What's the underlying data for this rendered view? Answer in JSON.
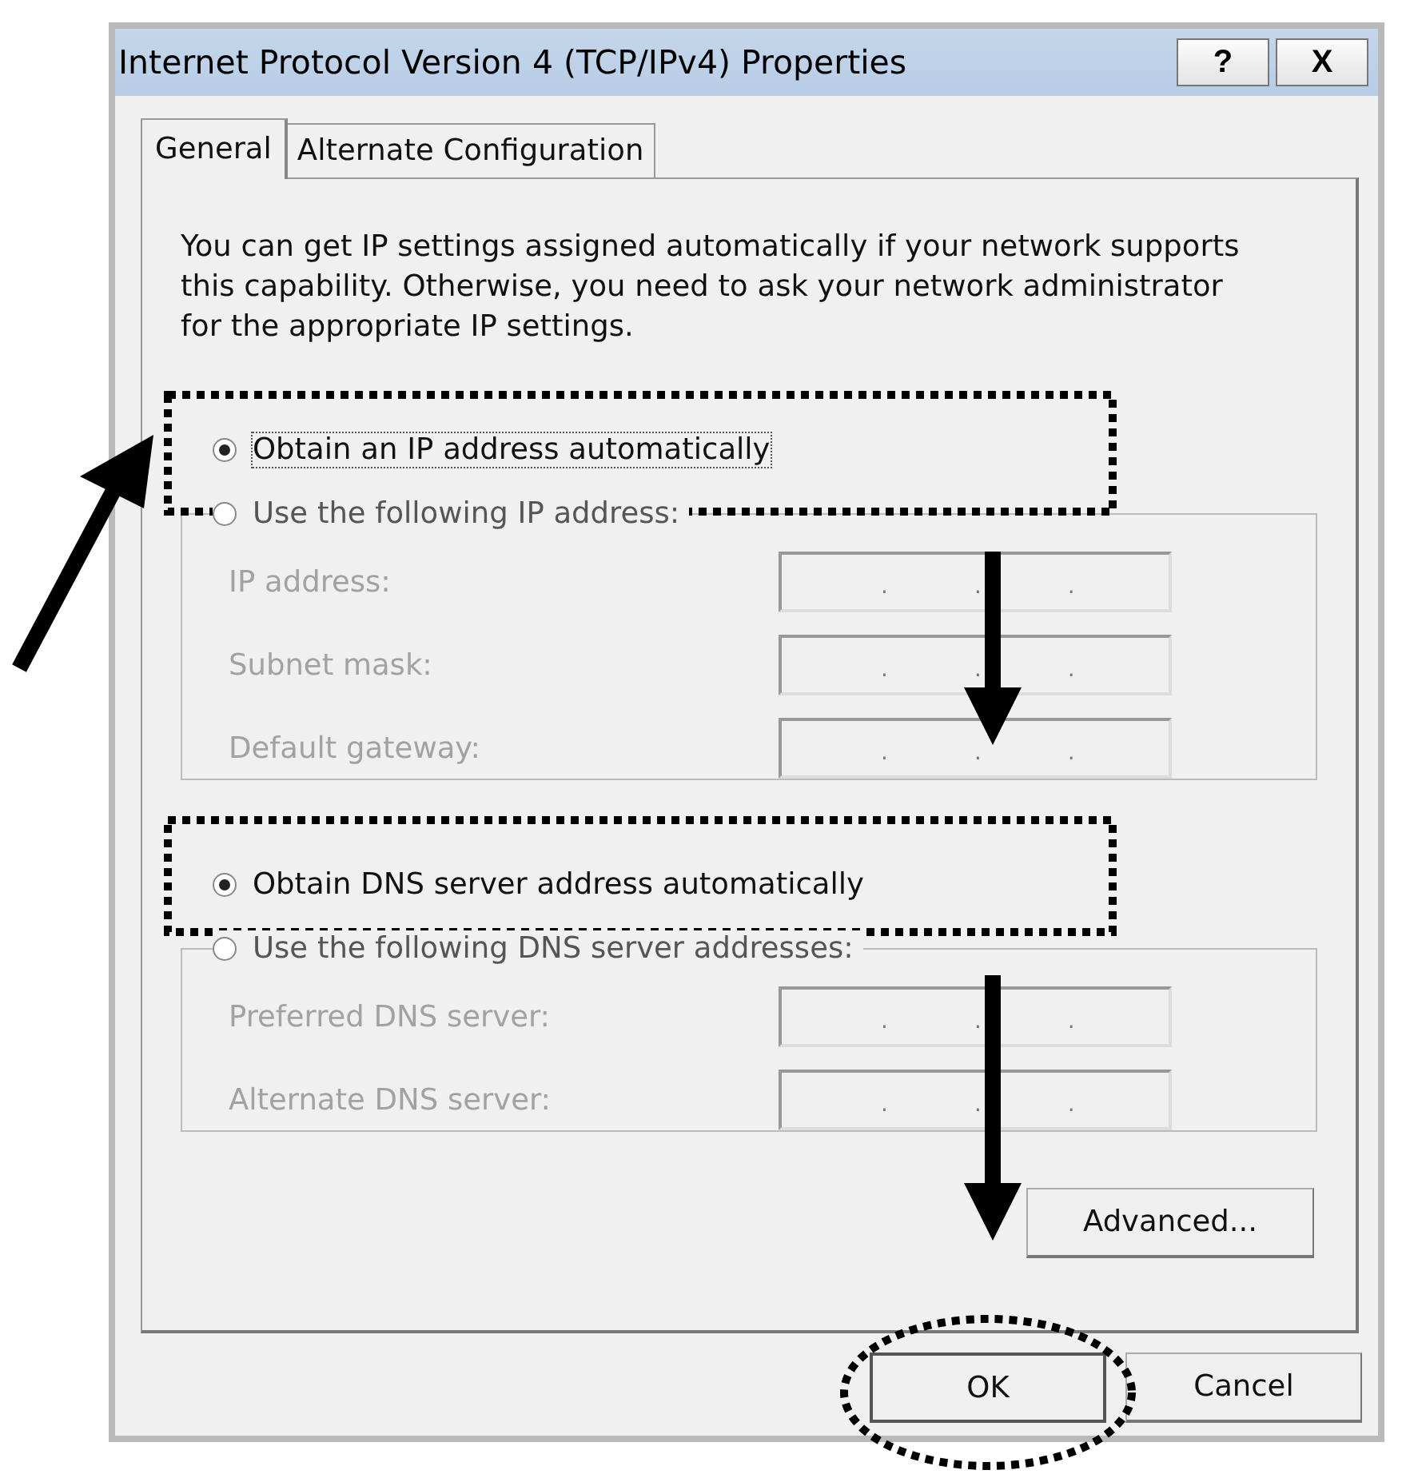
{
  "window": {
    "title": "Internet Protocol Version 4 (TCP/IPv4) Properties",
    "help_button": "?",
    "close_button": "X"
  },
  "tabs": [
    {
      "label": "General",
      "selected": true
    },
    {
      "label": "Alternate Configuration",
      "selected": false
    }
  ],
  "intro": "You can get IP settings assigned automatically if your network supports this capability. Otherwise, you need to ask your network administrator for the appropriate IP settings.",
  "ip_section": {
    "auto_option": {
      "label": "Obtain an IP address automatically",
      "selected": true
    },
    "manual_option": {
      "label": "Use the following IP address:",
      "selected": false
    },
    "fields": [
      {
        "label": "IP address:",
        "disabled": true,
        "dots": [
          ".",
          ".",
          "."
        ]
      },
      {
        "label": "Subnet mask:",
        "disabled": true,
        "dots": [
          ".",
          ".",
          "."
        ]
      },
      {
        "label": "Default gateway:",
        "disabled": true,
        "dots": [
          ".",
          ".",
          "."
        ]
      }
    ]
  },
  "dns_section": {
    "auto_option": {
      "label": "Obtain DNS server address automatically",
      "selected": true
    },
    "manual_option": {
      "label": "Use the following DNS server addresses:",
      "selected": false
    },
    "fields": [
      {
        "label": "Preferred DNS server:",
        "disabled": true,
        "dots": [
          ".",
          ".",
          "."
        ]
      },
      {
        "label": "Alternate DNS server:",
        "disabled": true,
        "dots": [
          ".",
          ".",
          "."
        ]
      }
    ]
  },
  "advanced_button": "Advanced...",
  "buttons": [
    {
      "label": "OK",
      "highlighted": true
    },
    {
      "label": "Cancel",
      "highlighted": false
    }
  ]
}
